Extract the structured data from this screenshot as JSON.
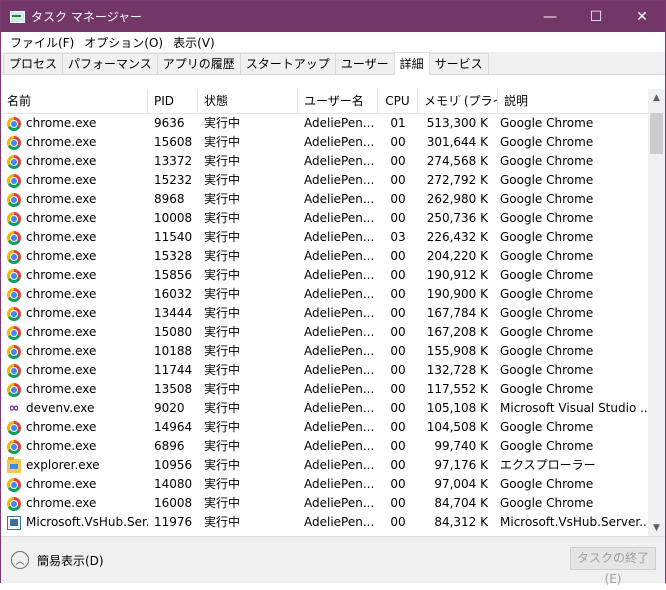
{
  "window": {
    "title": "タスク マネージャー",
    "controls": {
      "minimize": "—",
      "maximize": "☐",
      "close": "✕"
    }
  },
  "menu": [
    "ファイル(F)",
    "オプション(O)",
    "表示(V)"
  ],
  "tabs": [
    {
      "label": "プロセス",
      "active": false
    },
    {
      "label": "パフォーマンス",
      "active": false
    },
    {
      "label": "アプリの履歴",
      "active": false
    },
    {
      "label": "スタートアップ",
      "active": false
    },
    {
      "label": "ユーザー",
      "active": false
    },
    {
      "label": "詳細",
      "active": true
    },
    {
      "label": "サービス",
      "active": false
    }
  ],
  "columns": {
    "name": "名前",
    "pid": "PID",
    "state": "状態",
    "user": "ユーザー名",
    "cpu": "CPU",
    "memory": "メモリ (プライ...",
    "desc": "説明"
  },
  "rows": [
    {
      "icon": "chrome",
      "name": "chrome.exe",
      "pid": "9636",
      "state": "実行中",
      "user": "AdeliePen...",
      "cpu": "01",
      "mem": "513,300 K",
      "desc": "Google Chrome"
    },
    {
      "icon": "chrome",
      "name": "chrome.exe",
      "pid": "15608",
      "state": "実行中",
      "user": "AdeliePen...",
      "cpu": "00",
      "mem": "301,644 K",
      "desc": "Google Chrome"
    },
    {
      "icon": "chrome",
      "name": "chrome.exe",
      "pid": "13372",
      "state": "実行中",
      "user": "AdeliePen...",
      "cpu": "00",
      "mem": "274,568 K",
      "desc": "Google Chrome"
    },
    {
      "icon": "chrome",
      "name": "chrome.exe",
      "pid": "15232",
      "state": "実行中",
      "user": "AdeliePen...",
      "cpu": "00",
      "mem": "272,792 K",
      "desc": "Google Chrome"
    },
    {
      "icon": "chrome",
      "name": "chrome.exe",
      "pid": "8968",
      "state": "実行中",
      "user": "AdeliePen...",
      "cpu": "00",
      "mem": "262,980 K",
      "desc": "Google Chrome"
    },
    {
      "icon": "chrome",
      "name": "chrome.exe",
      "pid": "10008",
      "state": "実行中",
      "user": "AdeliePen...",
      "cpu": "00",
      "mem": "250,736 K",
      "desc": "Google Chrome"
    },
    {
      "icon": "chrome",
      "name": "chrome.exe",
      "pid": "11540",
      "state": "実行中",
      "user": "AdeliePen...",
      "cpu": "03",
      "mem": "226,432 K",
      "desc": "Google Chrome"
    },
    {
      "icon": "chrome",
      "name": "chrome.exe",
      "pid": "15328",
      "state": "実行中",
      "user": "AdeliePen...",
      "cpu": "00",
      "mem": "204,220 K",
      "desc": "Google Chrome"
    },
    {
      "icon": "chrome",
      "name": "chrome.exe",
      "pid": "15856",
      "state": "実行中",
      "user": "AdeliePen...",
      "cpu": "00",
      "mem": "190,912 K",
      "desc": "Google Chrome"
    },
    {
      "icon": "chrome",
      "name": "chrome.exe",
      "pid": "16032",
      "state": "実行中",
      "user": "AdeliePen...",
      "cpu": "00",
      "mem": "190,900 K",
      "desc": "Google Chrome"
    },
    {
      "icon": "chrome",
      "name": "chrome.exe",
      "pid": "13444",
      "state": "実行中",
      "user": "AdeliePen...",
      "cpu": "00",
      "mem": "167,784 K",
      "desc": "Google Chrome"
    },
    {
      "icon": "chrome",
      "name": "chrome.exe",
      "pid": "15080",
      "state": "実行中",
      "user": "AdeliePen...",
      "cpu": "00",
      "mem": "167,208 K",
      "desc": "Google Chrome"
    },
    {
      "icon": "chrome",
      "name": "chrome.exe",
      "pid": "10188",
      "state": "実行中",
      "user": "AdeliePen...",
      "cpu": "00",
      "mem": "155,908 K",
      "desc": "Google Chrome"
    },
    {
      "icon": "chrome",
      "name": "chrome.exe",
      "pid": "11744",
      "state": "実行中",
      "user": "AdeliePen...",
      "cpu": "00",
      "mem": "132,728 K",
      "desc": "Google Chrome"
    },
    {
      "icon": "chrome",
      "name": "chrome.exe",
      "pid": "13508",
      "state": "実行中",
      "user": "AdeliePen...",
      "cpu": "00",
      "mem": "117,552 K",
      "desc": "Google Chrome"
    },
    {
      "icon": "vs",
      "name": "devenv.exe",
      "pid": "9020",
      "state": "実行中",
      "user": "AdeliePen...",
      "cpu": "00",
      "mem": "105,108 K",
      "desc": "Microsoft Visual Studio ..."
    },
    {
      "icon": "chrome",
      "name": "chrome.exe",
      "pid": "14964",
      "state": "実行中",
      "user": "AdeliePen...",
      "cpu": "00",
      "mem": "104,508 K",
      "desc": "Google Chrome"
    },
    {
      "icon": "chrome",
      "name": "chrome.exe",
      "pid": "6896",
      "state": "実行中",
      "user": "AdeliePen...",
      "cpu": "00",
      "mem": "99,740 K",
      "desc": "Google Chrome"
    },
    {
      "icon": "explorer",
      "name": "explorer.exe",
      "pid": "10956",
      "state": "実行中",
      "user": "AdeliePen...",
      "cpu": "00",
      "mem": "97,176 K",
      "desc": "エクスプローラー"
    },
    {
      "icon": "chrome",
      "name": "chrome.exe",
      "pid": "14080",
      "state": "実行中",
      "user": "AdeliePen...",
      "cpu": "00",
      "mem": "97,004 K",
      "desc": "Google Chrome"
    },
    {
      "icon": "chrome",
      "name": "chrome.exe",
      "pid": "16008",
      "state": "実行中",
      "user": "AdeliePen...",
      "cpu": "00",
      "mem": "84,704 K",
      "desc": "Google Chrome"
    },
    {
      "icon": "winapp",
      "name": "Microsoft.VsHub.Ser...",
      "pid": "11976",
      "state": "実行中",
      "user": "AdeliePen...",
      "cpu": "00",
      "mem": "84,312 K",
      "desc": "Microsoft.VsHub.Server..."
    }
  ],
  "footer": {
    "fewer_details": "簡易表示(D)",
    "end_task": "タスクの終了(E)"
  }
}
